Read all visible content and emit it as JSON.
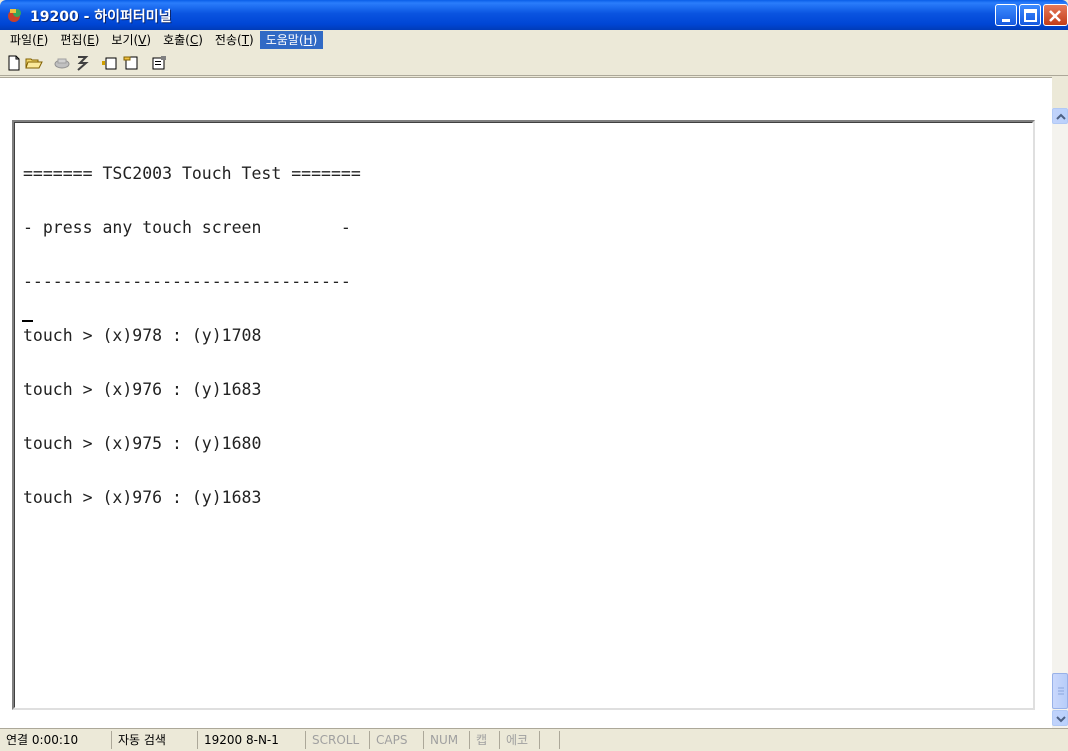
{
  "window": {
    "title": "19200 - 하이퍼터미널"
  },
  "menu": {
    "items": [
      {
        "label": "파일(",
        "acc": "F",
        "tail": ")"
      },
      {
        "label": "편집(",
        "acc": "E",
        "tail": ")"
      },
      {
        "label": "보기(",
        "acc": "V",
        "tail": ")"
      },
      {
        "label": "호출(",
        "acc": "C",
        "tail": ")"
      },
      {
        "label": "전송(",
        "acc": "T",
        "tail": ")"
      },
      {
        "label": "도움말(",
        "acc": "H",
        "tail": ")"
      }
    ]
  },
  "toolbar": {
    "icons": [
      "new-icon",
      "open-icon",
      "connect-icon",
      "disconnect-icon",
      "send-icon",
      "receive-icon",
      "properties-icon"
    ]
  },
  "terminal": {
    "lines": [
      "======= TSC2003 Touch Test =======",
      "- press any touch screen        -",
      "---------------------------------",
      "touch > (x)978 : (y)1708",
      "touch > (x)976 : (y)1683",
      "touch > (x)975 : (y)1680",
      "touch > (x)976 : (y)1683"
    ]
  },
  "status": {
    "connected": "연결 0:00:10",
    "detect": "자동 검색",
    "settings": "19200 8-N-1",
    "scroll": "SCROLL",
    "caps": "CAPS",
    "num": "NUM",
    "capture": "캡",
    "echo": "에코"
  },
  "colors": {
    "titlebar": "#0a54e0",
    "menu_active": "#316ac5",
    "background": "#ece9d8"
  }
}
